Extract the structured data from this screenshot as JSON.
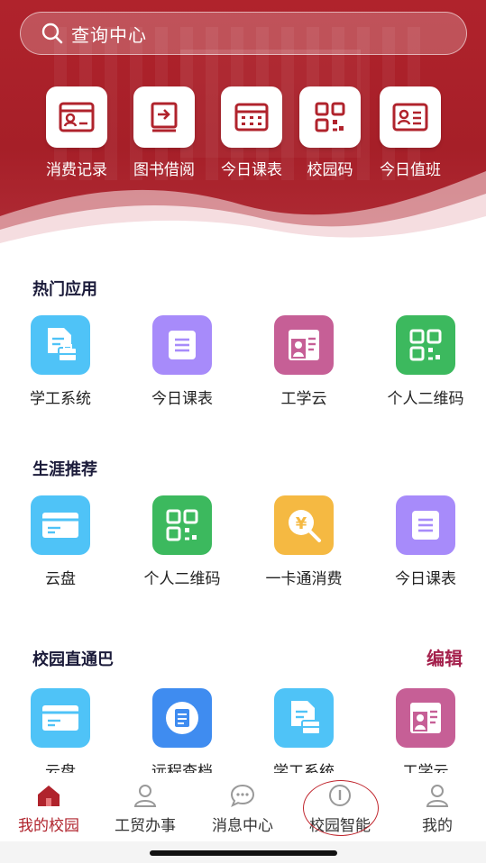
{
  "search": {
    "placeholder": "查询中心"
  },
  "quick_actions": [
    {
      "label": "消费记录",
      "icon": "id-card-icon"
    },
    {
      "label": "图书借阅",
      "icon": "book-icon"
    },
    {
      "label": "今日课表",
      "icon": "timetable-icon"
    },
    {
      "label": "校园码",
      "icon": "qr-code-icon"
    },
    {
      "label": "今日值班",
      "icon": "duty-card-icon"
    }
  ],
  "sections": {
    "hot": {
      "title": "热门应用",
      "apps": [
        {
          "label": "学工系统",
          "icon": "document-briefcase-icon",
          "color": "#4fc3f7"
        },
        {
          "label": "今日课表",
          "icon": "list-icon",
          "color": "#a78bfa"
        },
        {
          "label": "工学云",
          "icon": "profile-icon",
          "color": "#c65f96"
        },
        {
          "label": "个人二维码",
          "icon": "qr-code-icon",
          "color": "#3cb95e"
        }
      ]
    },
    "career": {
      "title": "生涯推荐",
      "apps": [
        {
          "label": "云盘",
          "icon": "card-icon",
          "color": "#4fc3f7"
        },
        {
          "label": "个人二维码",
          "icon": "qr-code-icon",
          "color": "#3cb95e"
        },
        {
          "label": "一卡通消费",
          "icon": "yen-search-icon",
          "color": "#f5b942"
        },
        {
          "label": "今日课表",
          "icon": "list-icon",
          "color": "#a78bfa"
        }
      ]
    },
    "campus": {
      "title": "校园直通巴",
      "edit_label": "编辑",
      "apps": [
        {
          "label": "云盘",
          "icon": "card-icon",
          "color": "#4fc3f7"
        },
        {
          "label": "远程查档",
          "icon": "globe-doc-icon",
          "color": "#3f8cf0"
        },
        {
          "label": "学工系统",
          "icon": "document-briefcase-icon",
          "color": "#4fc3f7"
        },
        {
          "label": "工学云",
          "icon": "profile-icon",
          "color": "#c65f96"
        }
      ]
    }
  },
  "bottom_nav": [
    {
      "label": "我的校园",
      "icon": "home-icon",
      "active": true
    },
    {
      "label": "工贸办事",
      "icon": "person-icon",
      "active": false
    },
    {
      "label": "消息中心",
      "icon": "chat-icon",
      "active": false
    },
    {
      "label": "校园智能",
      "icon": "info-icon",
      "active": false
    },
    {
      "label": "我的",
      "icon": "person-icon",
      "active": false
    }
  ],
  "colors": {
    "brand": "#b0232c",
    "edit": "#a4204c"
  }
}
